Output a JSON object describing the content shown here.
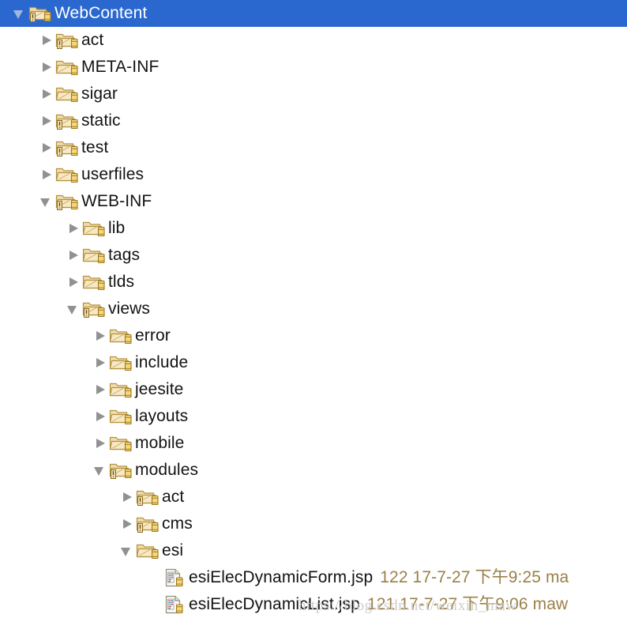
{
  "view": {
    "name": "project-explorer-tree",
    "selection_color": "#2A68CF",
    "label_color": "#131313",
    "meta_color": "#9B8047",
    "background": "#ffffff"
  },
  "watermark": {
    "text": "https://blog.csdn.net/weixin_maw"
  },
  "nodes": [
    {
      "label": "WebContent",
      "depth": 0,
      "type": "folder",
      "state": "expanded",
      "selected": true,
      "warning": true,
      "icon": "folder-open-icon"
    },
    {
      "label": "act",
      "depth": 1,
      "type": "folder",
      "state": "collapsed",
      "selected": false,
      "warning": true,
      "icon": "folder-open-icon"
    },
    {
      "label": "META-INF",
      "depth": 1,
      "type": "folder",
      "state": "collapsed",
      "selected": false,
      "warning": false,
      "icon": "folder-open-icon"
    },
    {
      "label": "sigar",
      "depth": 1,
      "type": "folder",
      "state": "collapsed",
      "selected": false,
      "warning": false,
      "icon": "folder-open-icon"
    },
    {
      "label": "static",
      "depth": 1,
      "type": "folder",
      "state": "collapsed",
      "selected": false,
      "warning": true,
      "icon": "folder-open-icon"
    },
    {
      "label": "test",
      "depth": 1,
      "type": "folder",
      "state": "collapsed",
      "selected": false,
      "warning": true,
      "icon": "folder-open-icon"
    },
    {
      "label": "userfiles",
      "depth": 1,
      "type": "folder",
      "state": "collapsed",
      "selected": false,
      "warning": false,
      "icon": "folder-open-icon"
    },
    {
      "label": "WEB-INF",
      "depth": 1,
      "type": "folder",
      "state": "expanded",
      "selected": false,
      "warning": true,
      "icon": "folder-open-icon"
    },
    {
      "label": "lib",
      "depth": 2,
      "type": "folder",
      "state": "collapsed",
      "selected": false,
      "warning": false,
      "icon": "folder-open-icon"
    },
    {
      "label": "tags",
      "depth": 2,
      "type": "folder",
      "state": "collapsed",
      "selected": false,
      "warning": false,
      "icon": "folder-open-icon"
    },
    {
      "label": "tlds",
      "depth": 2,
      "type": "folder",
      "state": "collapsed",
      "selected": false,
      "warning": false,
      "icon": "folder-open-icon"
    },
    {
      "label": "views",
      "depth": 2,
      "type": "folder",
      "state": "expanded",
      "selected": false,
      "warning": true,
      "icon": "folder-open-icon"
    },
    {
      "label": "error",
      "depth": 3,
      "type": "folder",
      "state": "collapsed",
      "selected": false,
      "warning": false,
      "icon": "folder-open-icon"
    },
    {
      "label": "include",
      "depth": 3,
      "type": "folder",
      "state": "collapsed",
      "selected": false,
      "warning": false,
      "icon": "folder-open-icon"
    },
    {
      "label": "jeesite",
      "depth": 3,
      "type": "folder",
      "state": "collapsed",
      "selected": false,
      "warning": false,
      "icon": "folder-open-icon"
    },
    {
      "label": "layouts",
      "depth": 3,
      "type": "folder",
      "state": "collapsed",
      "selected": false,
      "warning": false,
      "icon": "folder-open-icon"
    },
    {
      "label": "mobile",
      "depth": 3,
      "type": "folder",
      "state": "collapsed",
      "selected": false,
      "warning": false,
      "icon": "folder-open-icon"
    },
    {
      "label": "modules",
      "depth": 3,
      "type": "folder",
      "state": "expanded",
      "selected": false,
      "warning": true,
      "icon": "folder-open-icon"
    },
    {
      "label": "act",
      "depth": 4,
      "type": "folder",
      "state": "collapsed",
      "selected": false,
      "warning": true,
      "icon": "folder-open-icon"
    },
    {
      "label": "cms",
      "depth": 4,
      "type": "folder",
      "state": "collapsed",
      "selected": false,
      "warning": true,
      "icon": "folder-open-icon"
    },
    {
      "label": "esi",
      "depth": 4,
      "type": "folder",
      "state": "expanded",
      "selected": false,
      "warning": false,
      "icon": "folder-open-icon"
    },
    {
      "label": "esiElecDynamicForm.jsp",
      "depth": 5,
      "type": "file",
      "state": "none",
      "selected": false,
      "warning": false,
      "icon": "jsp-file-icon",
      "meta": "122  17-7-27 下午9:25  ma"
    },
    {
      "label": "esiElecDynamicList.jsp",
      "depth": 5,
      "type": "file",
      "state": "none",
      "selected": false,
      "warning": false,
      "icon": "jsp-file-icon",
      "meta": "121  17-7-27 下午9:06  maw"
    }
  ]
}
